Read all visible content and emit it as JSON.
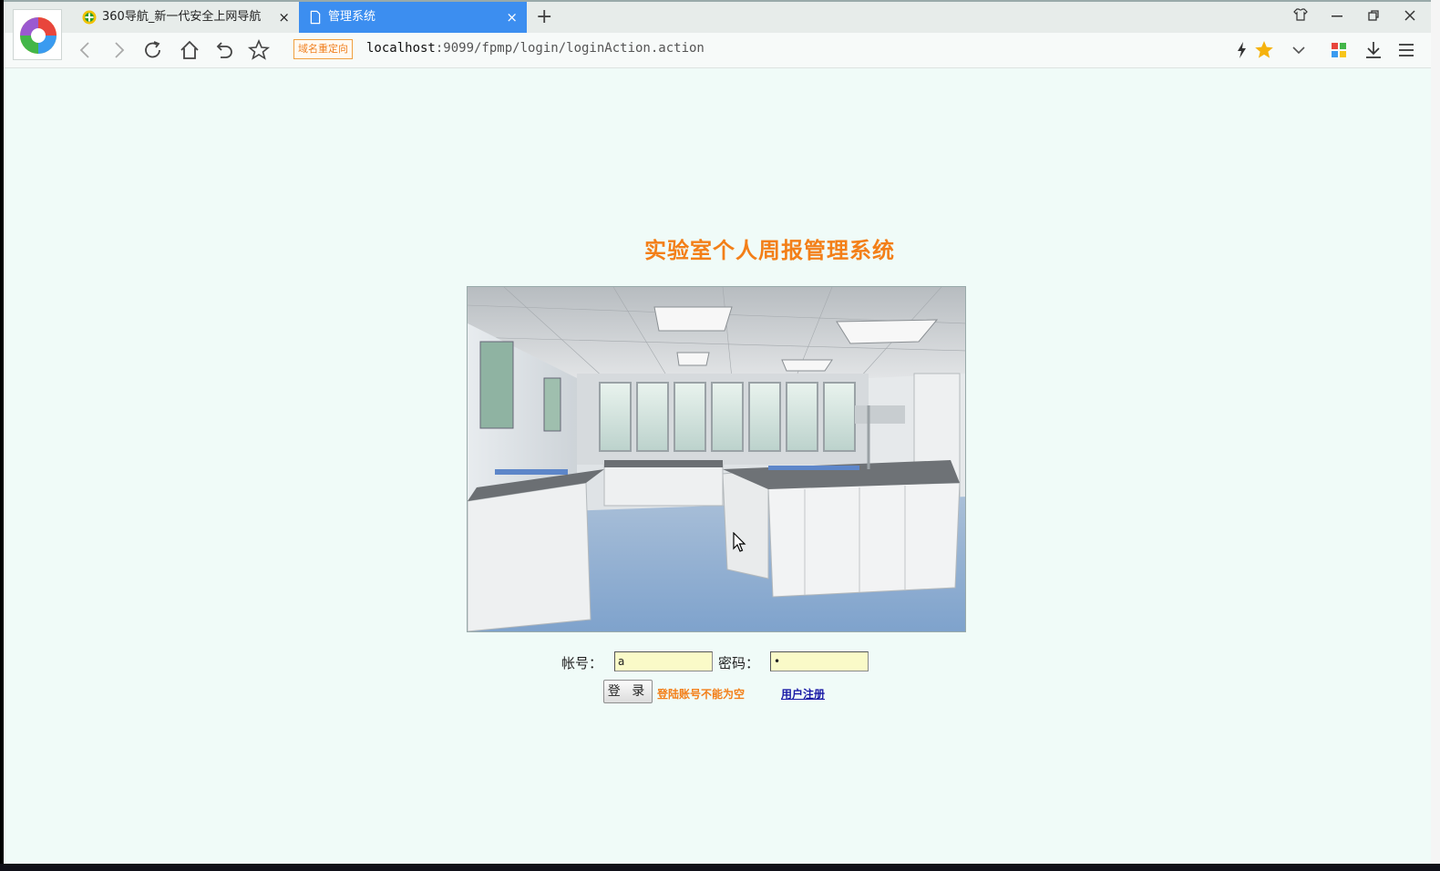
{
  "browser": {
    "tabs": [
      {
        "title": "360导航_新一代安全上网导航",
        "close": "×"
      },
      {
        "title": "管理系统",
        "close": "×",
        "active": true
      }
    ],
    "new_tab": "+",
    "address": {
      "badge": "域名重定向",
      "url_host": "localhost",
      "url_path": ":9099/fpmp/login/loginAction.action"
    },
    "icons": [
      "back-icon",
      "forward-icon",
      "reload-icon",
      "home-icon",
      "undo-icon",
      "star-icon",
      "lightning-icon",
      "favorite-star-icon",
      "dropdown-icon",
      "apps-icon",
      "download-icon",
      "menu-icon",
      "skin-icon",
      "minimize-icon",
      "restore-icon",
      "close-icon"
    ],
    "accent_color": "#3c8ef0"
  },
  "page": {
    "title": "实验室个人周报管理系统",
    "title_color": "#f37f18",
    "form": {
      "account_label": "帐号：",
      "account_value": "a",
      "password_label": "密码：",
      "password_value": "•",
      "login_button": "登 录",
      "error_message": "登陆账号不能为空",
      "register_link": "用户注册"
    }
  }
}
